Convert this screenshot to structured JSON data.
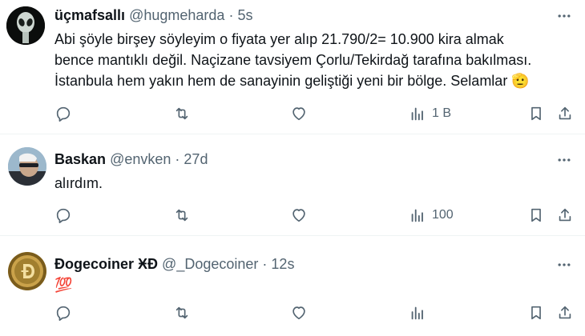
{
  "tweets": [
    {
      "display_name": "üçmafsallı",
      "handle": "@hugmeharda",
      "separator": "·",
      "time": "5s",
      "lines": [
        "Abi şöyle birşey söyleyim o fiyata yer alıp 21.790/2= 10.900 kira almak",
        "bence mantıklı değil. Naçizane tavsiyem Çorlu/Tekirdağ tarafına bakılması.",
        "İstanbula hem yakın hem de sanayinin geliştiği yeni bir bölge. Selamlar"
      ],
      "emoji": "🫡",
      "views": "1 B"
    },
    {
      "display_name": "Baskan",
      "handle": "@envken",
      "separator": "·",
      "time": "27d",
      "lines": [
        "alırdım."
      ],
      "views": "100"
    },
    {
      "display_name": "Ðogecoiner ӾÐ",
      "handle": "@_Dogecoiner",
      "separator": "·",
      "time": "12s",
      "lines": [
        "💯"
      ],
      "views": ""
    }
  ],
  "icons": {
    "reply": "reply-icon",
    "retweet": "retweet-icon",
    "like": "heart-icon",
    "views": "views-icon",
    "bookmark": "bookmark-icon",
    "share": "share-icon",
    "more": "more-icon"
  },
  "colors": {
    "text": "#0f1419",
    "secondary": "#536471",
    "divider": "#eff3f4"
  }
}
